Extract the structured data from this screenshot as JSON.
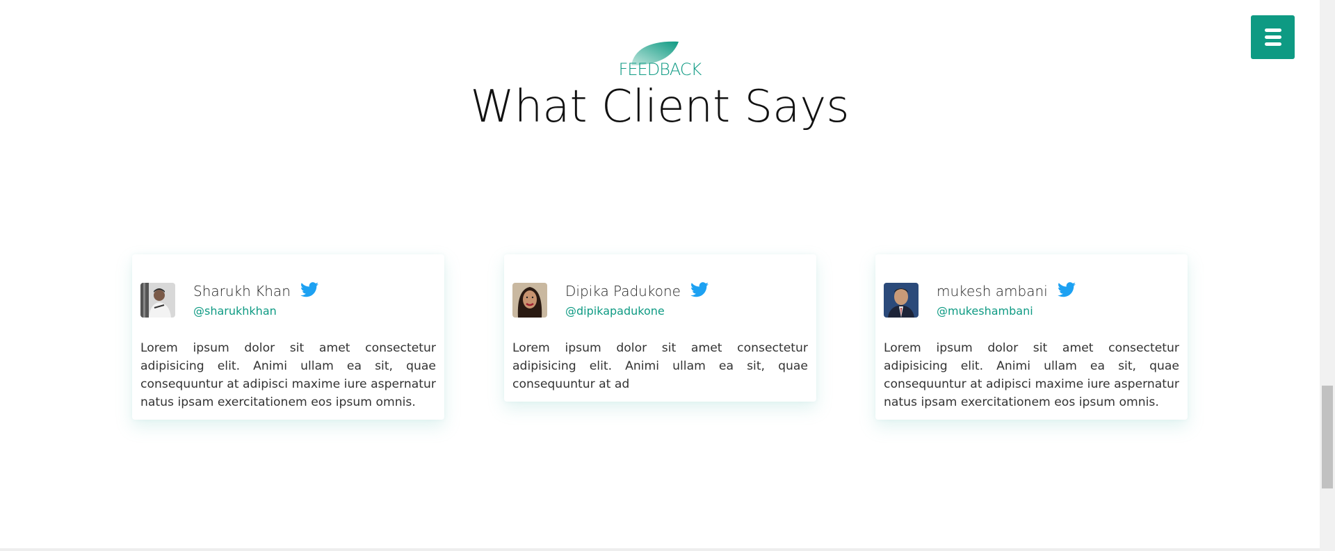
{
  "header": {
    "eyebrow": "FEEDBACK",
    "title": "What Client Says"
  },
  "menu": {
    "icon": "hamburger-icon"
  },
  "colors": {
    "accent": "#0e9a83",
    "twitter": "#1da1f2"
  },
  "testimonials": [
    {
      "name": "Sharukh Khan",
      "handle": "@sharukhkhan",
      "icon": "twitter-icon",
      "quote": "Lorem ipsum dolor sit amet consectetur adipisicing elit. Animi ullam ea sit, quae consequuntur at adipisci maxime iure aspernatur natus ipsam exercitationem eos ipsum omnis."
    },
    {
      "name": "Dipika Padukone",
      "handle": "@dipikapadukone",
      "icon": "twitter-icon",
      "quote": "Lorem ipsum dolor sit amet consectetur adipisicing elit. Animi ullam ea sit, quae consequuntur at ad"
    },
    {
      "name": "mukesh ambani",
      "handle": "@mukeshambani",
      "icon": "twitter-icon",
      "quote": "Lorem ipsum dolor sit amet consectetur adipisicing elit. Animi ullam ea sit, quae consequuntur at adipisci maxime iure aspernatur natus ipsam exercitationem eos ipsum omnis."
    }
  ]
}
